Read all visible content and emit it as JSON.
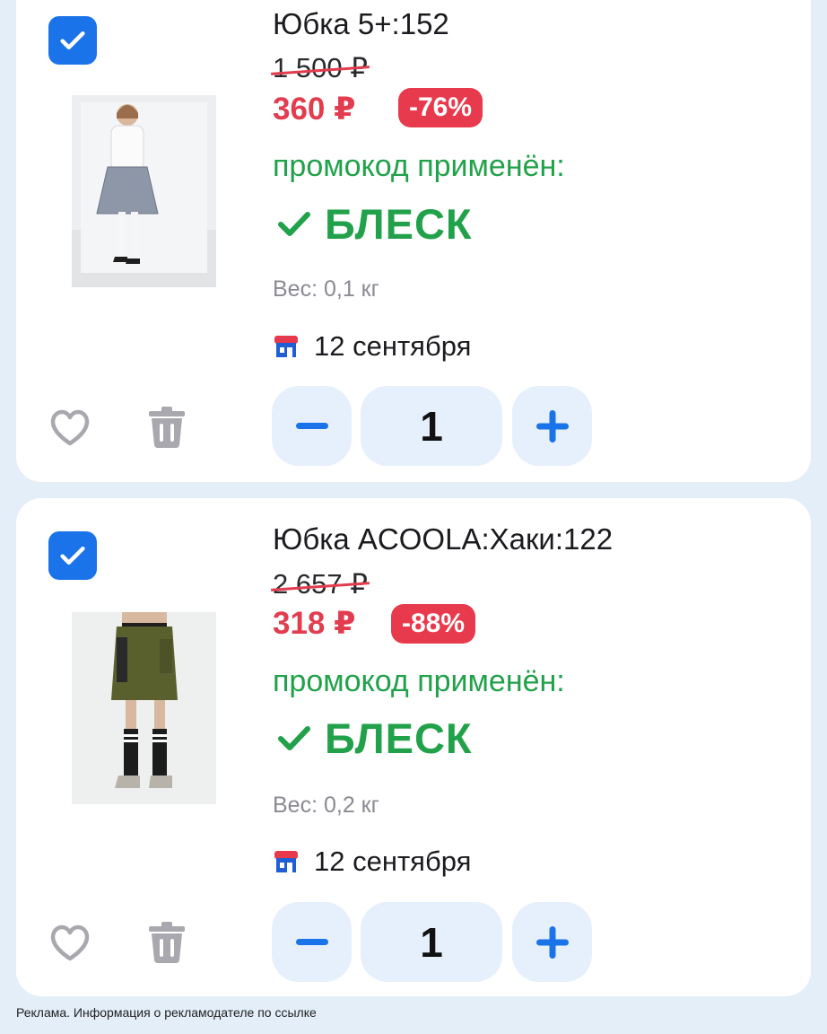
{
  "items": [
    {
      "title": "Юбка 5+:152",
      "old_price": "1 500 ₽",
      "new_price": "360 ₽",
      "discount": "-76%",
      "promo_label": "промокод применён:",
      "promo_code": "БЛЕСК",
      "weight": "Вес: 0,1 кг",
      "delivery_date": "12 сентября",
      "quantity": "1",
      "selected": true
    },
    {
      "title": "Юбка ACOOLA:Хаки:122",
      "old_price": "2 657 ₽",
      "new_price": "318 ₽",
      "discount": "-88%",
      "promo_label": "промокод применён:",
      "promo_code": "БЛЕСК",
      "weight": "Вес: 0,2 кг",
      "delivery_date": "12 сентября",
      "quantity": "1",
      "selected": true
    }
  ],
  "footer": {
    "ad_notice": "Реклама. Информация о рекламодателе по ссылке"
  },
  "colors": {
    "accent_blue": "#1a73e8",
    "price_red": "#e23c4e",
    "promo_green": "#21a14a",
    "stepper_bg": "#e6f0fd",
    "page_bg": "#e3eef9"
  },
  "icons": [
    "checkbox-checked-icon",
    "heart-icon",
    "trash-icon",
    "minus-icon",
    "plus-icon",
    "checkmark-icon",
    "store-icon"
  ]
}
